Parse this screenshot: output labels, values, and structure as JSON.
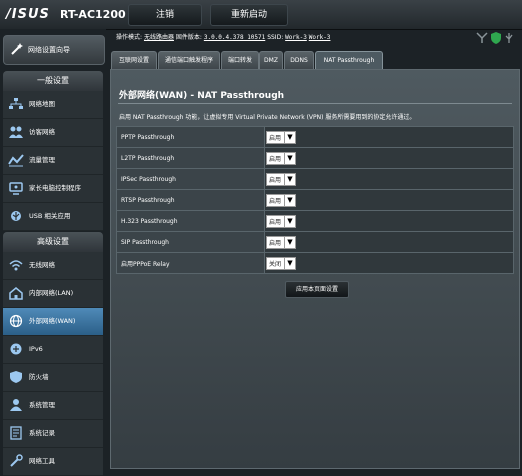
{
  "header": {
    "logo": "/ISUS",
    "model": "RT-AC1200",
    "logout_label": "注销",
    "reboot_label": "重新启动"
  },
  "status": {
    "mode_label": "操作模式:",
    "mode_value": "无线路由器",
    "firmware_label": "固件版本:",
    "firmware_value": "3.0.0.4.378_10571",
    "ssid_label": "SSID:",
    "ssid_1": "Work-3",
    "ssid_2": "Work-3"
  },
  "sidebar": {
    "qis_label": "网络设置向导",
    "general_title": "一般设置",
    "general_items": [
      {
        "label": "网络地图",
        "icon": "network-map-icon"
      },
      {
        "label": "访客网络",
        "icon": "guest-network-icon"
      },
      {
        "label": "流量管理",
        "icon": "traffic-manager-icon"
      },
      {
        "label": "家长电脑控制程序",
        "icon": "parental-control-icon"
      },
      {
        "label": "USB 相关应用",
        "icon": "usb-icon"
      }
    ],
    "advanced_title": "高级设置",
    "advanced_items": [
      {
        "label": "无线网络",
        "icon": "wireless-icon"
      },
      {
        "label": "内部网络(LAN)",
        "icon": "lan-icon"
      },
      {
        "label": "外部网络(WAN)",
        "icon": "wan-icon",
        "active": true
      },
      {
        "label": "IPv6",
        "icon": "ipv6-icon"
      },
      {
        "label": "防火墙",
        "icon": "firewall-icon"
      },
      {
        "label": "系统管理",
        "icon": "administration-icon"
      },
      {
        "label": "系统记录",
        "icon": "system-log-icon"
      },
      {
        "label": "网络工具",
        "icon": "network-tools-icon"
      }
    ]
  },
  "tabs": [
    {
      "label": "互联网设置"
    },
    {
      "label": "通信端口触发程序"
    },
    {
      "label": "端口转发"
    },
    {
      "label": "DMZ"
    },
    {
      "label": "DDNS"
    },
    {
      "label": "NAT Passthrough",
      "active": true
    }
  ],
  "page": {
    "title": "外部网络(WAN) - NAT Passthrough",
    "description": "启用 NAT Passthrough 功能，让虚拟专用 Virtual Private Network (VPN) 服务所需要用到的协定允许通过。",
    "rows": [
      {
        "label": "PPTP Passthrough",
        "value": "启用"
      },
      {
        "label": "L2TP Passthrough",
        "value": "启用"
      },
      {
        "label": "IPSec Passthrough",
        "value": "启用"
      },
      {
        "label": "RTSP Passthrough",
        "value": "启用"
      },
      {
        "label": "H.323 Passthrough",
        "value": "启用"
      },
      {
        "label": "SIP Passthrough",
        "value": "启用"
      },
      {
        "label": "启用PPPoE Relay",
        "value": "关闭"
      }
    ],
    "apply_label": "应用本页面设置"
  },
  "colors": {
    "background": "#1c2226",
    "panel": "#4a555b",
    "active_menu": "#3d78a8"
  }
}
